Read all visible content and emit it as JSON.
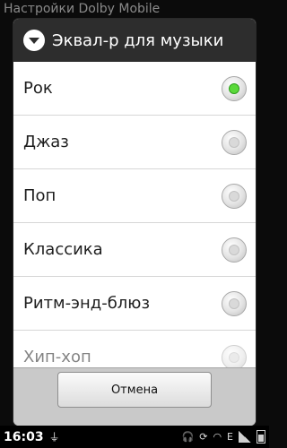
{
  "background": {
    "title": "Настройки Dolby Mobile"
  },
  "dialog": {
    "title": "Эквал-р для музыки",
    "items": [
      {
        "label": "Рок",
        "checked": true
      },
      {
        "label": "Джаз",
        "checked": false
      },
      {
        "label": "Поп",
        "checked": false
      },
      {
        "label": "Классика",
        "checked": false
      },
      {
        "label": "Ритм-энд-блюз",
        "checked": false
      },
      {
        "label": "Хип-хоп",
        "checked": false
      }
    ],
    "cancel_label": "Отмена"
  },
  "statusbar": {
    "time": "16:03",
    "network_label": "E",
    "icons": [
      "usb-icon",
      "headset-icon",
      "sync-icon",
      "wifi-icon",
      "signal-icon",
      "battery-icon"
    ]
  },
  "colors": {
    "selected_radio": "#5ad93a",
    "header_bg": "#2d2d2d"
  }
}
